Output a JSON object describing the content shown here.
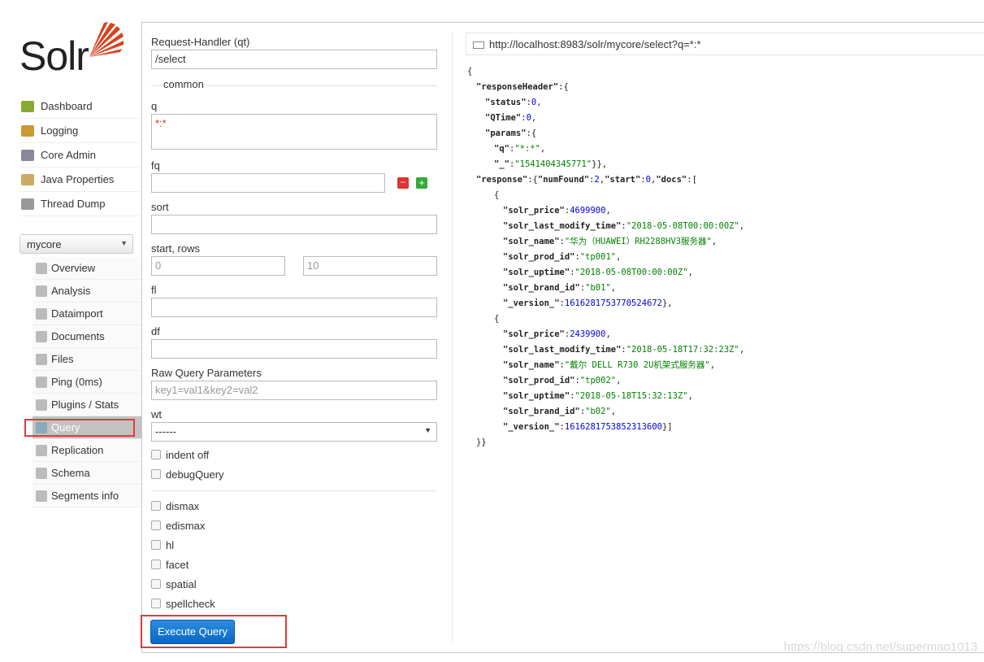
{
  "logo": {
    "text": "Solr"
  },
  "nav": [
    {
      "label": "Dashboard",
      "icon": "dashboard-icon"
    },
    {
      "label": "Logging",
      "icon": "logging-icon"
    },
    {
      "label": "Core Admin",
      "icon": "core-admin-icon"
    },
    {
      "label": "Java Properties",
      "icon": "java-icon"
    },
    {
      "label": "Thread Dump",
      "icon": "thread-dump-icon"
    }
  ],
  "core_selector": {
    "value": "mycore"
  },
  "core_nav": [
    {
      "label": "Overview"
    },
    {
      "label": "Analysis"
    },
    {
      "label": "Dataimport"
    },
    {
      "label": "Documents"
    },
    {
      "label": "Files"
    },
    {
      "label": "Ping (0ms)"
    },
    {
      "label": "Plugins / Stats"
    },
    {
      "label": "Query",
      "active": true
    },
    {
      "label": "Replication"
    },
    {
      "label": "Schema"
    },
    {
      "label": "Segments info"
    }
  ],
  "form": {
    "qt_label": "Request-Handler (qt)",
    "qt_value": "/select",
    "common_label": "common",
    "q_label": "q",
    "q_value": "*:*",
    "fq_label": "fq",
    "fq_value": "",
    "sort_label": "sort",
    "start_rows_label": "start, rows",
    "start_value": "0",
    "rows_value": "10",
    "fl_label": "fl",
    "df_label": "df",
    "raw_label": "Raw Query Parameters",
    "raw_placeholder": "key1=val1&key2=val2",
    "wt_label": "wt",
    "wt_value": "------",
    "checks1": [
      "indent off",
      "debugQuery"
    ],
    "checks2": [
      "dismax",
      "edismax",
      "hl",
      "facet",
      "spatial",
      "spellcheck"
    ],
    "execute": "Execute Query"
  },
  "result_url": "http://localhost:8983/solr/mycore/select?q=*:*",
  "json_lines": [
    [
      0,
      [
        [
          "p",
          "{"
        ]
      ]
    ],
    [
      1,
      [
        [
          "k",
          "\"responseHeader\""
        ],
        [
          "p",
          ":{"
        ]
      ]
    ],
    [
      2,
      [
        [
          "k",
          "\"status\""
        ],
        [
          "p",
          ":"
        ],
        [
          "n",
          "0"
        ],
        [
          "p",
          ","
        ]
      ]
    ],
    [
      2,
      [
        [
          "k",
          "\"QTime\""
        ],
        [
          "p",
          ":"
        ],
        [
          "n",
          "0"
        ],
        [
          "p",
          ","
        ]
      ]
    ],
    [
      2,
      [
        [
          "k",
          "\"params\""
        ],
        [
          "p",
          ":{"
        ]
      ]
    ],
    [
      3,
      [
        [
          "k",
          "\"q\""
        ],
        [
          "p",
          ":"
        ],
        [
          "s",
          "\"*:*\""
        ],
        [
          "p",
          ","
        ]
      ]
    ],
    [
      3,
      [
        [
          "k",
          "\"_\""
        ],
        [
          "p",
          ":"
        ],
        [
          "s",
          "\"1541404345771\""
        ],
        [
          "p",
          "}},"
        ]
      ]
    ],
    [
      1,
      [
        [
          "k",
          "\"response\""
        ],
        [
          "p",
          ":{"
        ],
        [
          "k",
          "\"numFound\""
        ],
        [
          "p",
          ":"
        ],
        [
          "n",
          "2"
        ],
        [
          "p",
          ","
        ],
        [
          "k",
          "\"start\""
        ],
        [
          "p",
          ":"
        ],
        [
          "n",
          "0"
        ],
        [
          "p",
          ","
        ],
        [
          "k",
          "\"docs\""
        ],
        [
          "p",
          ":["
        ]
      ]
    ],
    [
      3,
      [
        [
          "p",
          "{"
        ]
      ]
    ],
    [
      4,
      [
        [
          "k",
          "\"solr_price\""
        ],
        [
          "p",
          ":"
        ],
        [
          "n",
          "4699900"
        ],
        [
          "p",
          ","
        ]
      ]
    ],
    [
      4,
      [
        [
          "k",
          "\"solr_last_modify_time\""
        ],
        [
          "p",
          ":"
        ],
        [
          "s",
          "\"2018-05-08T00:00:00Z\""
        ],
        [
          "p",
          ","
        ]
      ]
    ],
    [
      4,
      [
        [
          "k",
          "\"solr_name\""
        ],
        [
          "p",
          ":"
        ],
        [
          "s",
          "\"华为（HUAWEI）RH2288HV3服务器\""
        ],
        [
          "p",
          ","
        ]
      ]
    ],
    [
      4,
      [
        [
          "k",
          "\"solr_prod_id\""
        ],
        [
          "p",
          ":"
        ],
        [
          "s",
          "\"tp001\""
        ],
        [
          "p",
          ","
        ]
      ]
    ],
    [
      4,
      [
        [
          "k",
          "\"solr_uptime\""
        ],
        [
          "p",
          ":"
        ],
        [
          "s",
          "\"2018-05-08T00:00:00Z\""
        ],
        [
          "p",
          ","
        ]
      ]
    ],
    [
      4,
      [
        [
          "k",
          "\"solr_brand_id\""
        ],
        [
          "p",
          ":"
        ],
        [
          "s",
          "\"b01\""
        ],
        [
          "p",
          ","
        ]
      ]
    ],
    [
      4,
      [
        [
          "k",
          "\"_version_\""
        ],
        [
          "p",
          ":"
        ],
        [
          "n",
          "1616281753770524672"
        ],
        [
          "p",
          "},"
        ]
      ]
    ],
    [
      3,
      [
        [
          "p",
          "{"
        ]
      ]
    ],
    [
      4,
      [
        [
          "k",
          "\"solr_price\""
        ],
        [
          "p",
          ":"
        ],
        [
          "n",
          "2439900"
        ],
        [
          "p",
          ","
        ]
      ]
    ],
    [
      4,
      [
        [
          "k",
          "\"solr_last_modify_time\""
        ],
        [
          "p",
          ":"
        ],
        [
          "s",
          "\"2018-05-18T17:32:23Z\""
        ],
        [
          "p",
          ","
        ]
      ]
    ],
    [
      4,
      [
        [
          "k",
          "\"solr_name\""
        ],
        [
          "p",
          ":"
        ],
        [
          "s",
          "\"戴尔 DELL R730 2U机架式服务器\""
        ],
        [
          "p",
          ","
        ]
      ]
    ],
    [
      4,
      [
        [
          "k",
          "\"solr_prod_id\""
        ],
        [
          "p",
          ":"
        ],
        [
          "s",
          "\"tp002\""
        ],
        [
          "p",
          ","
        ]
      ]
    ],
    [
      4,
      [
        [
          "k",
          "\"solr_uptime\""
        ],
        [
          "p",
          ":"
        ],
        [
          "s",
          "\"2018-05-18T15:32:13Z\""
        ],
        [
          "p",
          ","
        ]
      ]
    ],
    [
      4,
      [
        [
          "k",
          "\"solr_brand_id\""
        ],
        [
          "p",
          ":"
        ],
        [
          "s",
          "\"b02\""
        ],
        [
          "p",
          ","
        ]
      ]
    ],
    [
      4,
      [
        [
          "k",
          "\"_version_\""
        ],
        [
          "p",
          ":"
        ],
        [
          "n",
          "1616281753852313600"
        ],
        [
          "p",
          "}]"
        ]
      ]
    ],
    [
      1,
      [
        [
          "p",
          "}}"
        ]
      ]
    ]
  ],
  "watermark": "https://blog.csdn.net/supermao1013"
}
